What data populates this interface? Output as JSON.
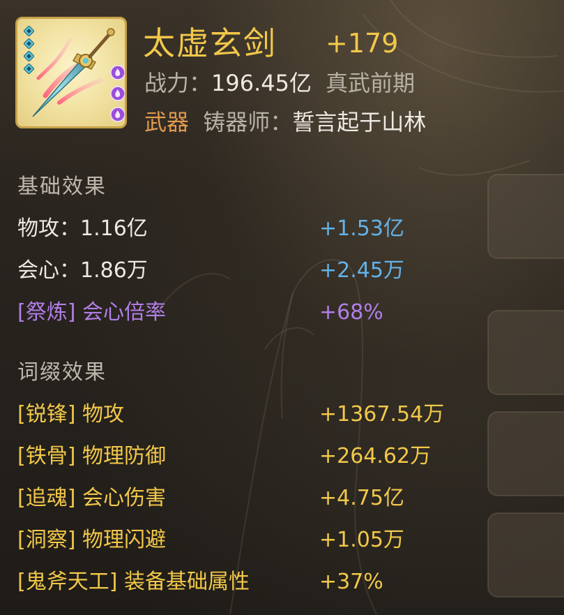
{
  "item": {
    "name": "太虚玄剑",
    "level": "+179",
    "power_label": "战力：",
    "power_value": "196.45亿",
    "realm": "真武前期",
    "type": "武器",
    "smith_label": "铸器师：",
    "smith_name": "誓言起于山林",
    "icon": "sword-icon",
    "gem_count": 4,
    "orb_count": 3
  },
  "base_effects": {
    "title": "基础效果",
    "rows": [
      {
        "label": "物攻：1.16亿",
        "value": "+1.53亿",
        "color": "#64b2e8"
      },
      {
        "label": "会心：1.86万",
        "value": "+2.45万",
        "color": "#64b2e8"
      },
      {
        "label": "[祭炼] 会心倍率",
        "value": "+68%",
        "color": "#b27ee8"
      }
    ]
  },
  "affix_effects": {
    "title": "词缀效果",
    "rows": [
      {
        "label": "[锐锋] 物攻",
        "value": "+1367.54万"
      },
      {
        "label": "[铁骨] 物理防御",
        "value": "+264.62万"
      },
      {
        "label": "[追魂] 会心伤害",
        "value": "+4.75亿"
      },
      {
        "label": "[洞察] 物理闪避",
        "value": "+1.05万"
      },
      {
        "label": "[鬼斧天工] 装备基础属性",
        "value": "+37%"
      }
    ]
  },
  "colors": {
    "gold": "#f2c84a",
    "blue": "#64b2e8",
    "purple": "#b27ee8",
    "orange": "#e09a4f",
    "muted": "#b7b1a6"
  }
}
